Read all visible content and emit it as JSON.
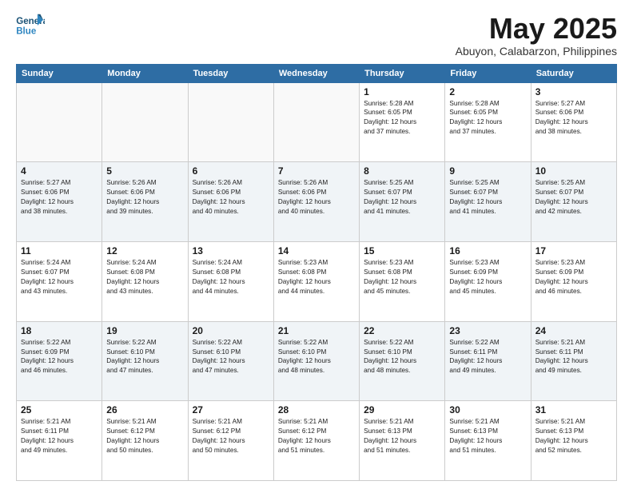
{
  "logo": {
    "line1": "General",
    "line2": "Blue"
  },
  "title": "May 2025",
  "subtitle": "Abuyon, Calabarzon, Philippines",
  "days_of_week": [
    "Sunday",
    "Monday",
    "Tuesday",
    "Wednesday",
    "Thursday",
    "Friday",
    "Saturday"
  ],
  "weeks": [
    [
      {
        "day": "",
        "info": ""
      },
      {
        "day": "",
        "info": ""
      },
      {
        "day": "",
        "info": ""
      },
      {
        "day": "",
        "info": ""
      },
      {
        "day": "1",
        "info": "Sunrise: 5:28 AM\nSunset: 6:05 PM\nDaylight: 12 hours\nand 37 minutes."
      },
      {
        "day": "2",
        "info": "Sunrise: 5:28 AM\nSunset: 6:05 PM\nDaylight: 12 hours\nand 37 minutes."
      },
      {
        "day": "3",
        "info": "Sunrise: 5:27 AM\nSunset: 6:06 PM\nDaylight: 12 hours\nand 38 minutes."
      }
    ],
    [
      {
        "day": "4",
        "info": "Sunrise: 5:27 AM\nSunset: 6:06 PM\nDaylight: 12 hours\nand 38 minutes."
      },
      {
        "day": "5",
        "info": "Sunrise: 5:26 AM\nSunset: 6:06 PM\nDaylight: 12 hours\nand 39 minutes."
      },
      {
        "day": "6",
        "info": "Sunrise: 5:26 AM\nSunset: 6:06 PM\nDaylight: 12 hours\nand 40 minutes."
      },
      {
        "day": "7",
        "info": "Sunrise: 5:26 AM\nSunset: 6:06 PM\nDaylight: 12 hours\nand 40 minutes."
      },
      {
        "day": "8",
        "info": "Sunrise: 5:25 AM\nSunset: 6:07 PM\nDaylight: 12 hours\nand 41 minutes."
      },
      {
        "day": "9",
        "info": "Sunrise: 5:25 AM\nSunset: 6:07 PM\nDaylight: 12 hours\nand 41 minutes."
      },
      {
        "day": "10",
        "info": "Sunrise: 5:25 AM\nSunset: 6:07 PM\nDaylight: 12 hours\nand 42 minutes."
      }
    ],
    [
      {
        "day": "11",
        "info": "Sunrise: 5:24 AM\nSunset: 6:07 PM\nDaylight: 12 hours\nand 43 minutes."
      },
      {
        "day": "12",
        "info": "Sunrise: 5:24 AM\nSunset: 6:08 PM\nDaylight: 12 hours\nand 43 minutes."
      },
      {
        "day": "13",
        "info": "Sunrise: 5:24 AM\nSunset: 6:08 PM\nDaylight: 12 hours\nand 44 minutes."
      },
      {
        "day": "14",
        "info": "Sunrise: 5:23 AM\nSunset: 6:08 PM\nDaylight: 12 hours\nand 44 minutes."
      },
      {
        "day": "15",
        "info": "Sunrise: 5:23 AM\nSunset: 6:08 PM\nDaylight: 12 hours\nand 45 minutes."
      },
      {
        "day": "16",
        "info": "Sunrise: 5:23 AM\nSunset: 6:09 PM\nDaylight: 12 hours\nand 45 minutes."
      },
      {
        "day": "17",
        "info": "Sunrise: 5:23 AM\nSunset: 6:09 PM\nDaylight: 12 hours\nand 46 minutes."
      }
    ],
    [
      {
        "day": "18",
        "info": "Sunrise: 5:22 AM\nSunset: 6:09 PM\nDaylight: 12 hours\nand 46 minutes."
      },
      {
        "day": "19",
        "info": "Sunrise: 5:22 AM\nSunset: 6:10 PM\nDaylight: 12 hours\nand 47 minutes."
      },
      {
        "day": "20",
        "info": "Sunrise: 5:22 AM\nSunset: 6:10 PM\nDaylight: 12 hours\nand 47 minutes."
      },
      {
        "day": "21",
        "info": "Sunrise: 5:22 AM\nSunset: 6:10 PM\nDaylight: 12 hours\nand 48 minutes."
      },
      {
        "day": "22",
        "info": "Sunrise: 5:22 AM\nSunset: 6:10 PM\nDaylight: 12 hours\nand 48 minutes."
      },
      {
        "day": "23",
        "info": "Sunrise: 5:22 AM\nSunset: 6:11 PM\nDaylight: 12 hours\nand 49 minutes."
      },
      {
        "day": "24",
        "info": "Sunrise: 5:21 AM\nSunset: 6:11 PM\nDaylight: 12 hours\nand 49 minutes."
      }
    ],
    [
      {
        "day": "25",
        "info": "Sunrise: 5:21 AM\nSunset: 6:11 PM\nDaylight: 12 hours\nand 49 minutes."
      },
      {
        "day": "26",
        "info": "Sunrise: 5:21 AM\nSunset: 6:12 PM\nDaylight: 12 hours\nand 50 minutes."
      },
      {
        "day": "27",
        "info": "Sunrise: 5:21 AM\nSunset: 6:12 PM\nDaylight: 12 hours\nand 50 minutes."
      },
      {
        "day": "28",
        "info": "Sunrise: 5:21 AM\nSunset: 6:12 PM\nDaylight: 12 hours\nand 51 minutes."
      },
      {
        "day": "29",
        "info": "Sunrise: 5:21 AM\nSunset: 6:13 PM\nDaylight: 12 hours\nand 51 minutes."
      },
      {
        "day": "30",
        "info": "Sunrise: 5:21 AM\nSunset: 6:13 PM\nDaylight: 12 hours\nand 51 minutes."
      },
      {
        "day": "31",
        "info": "Sunrise: 5:21 AM\nSunset: 6:13 PM\nDaylight: 12 hours\nand 52 minutes."
      }
    ]
  ]
}
